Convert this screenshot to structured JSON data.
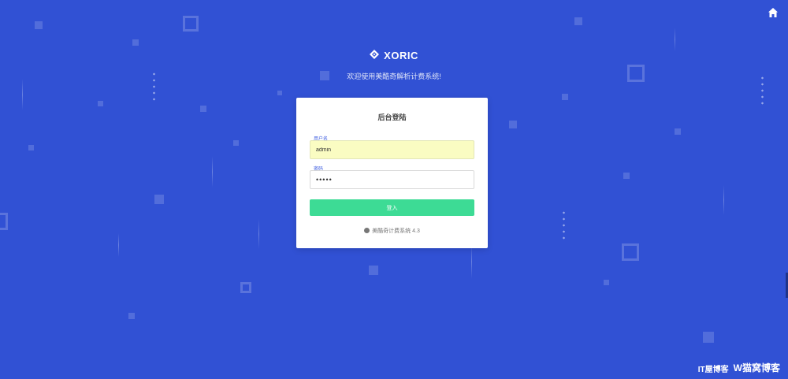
{
  "header": {
    "home_icon": "home-icon"
  },
  "brand": {
    "logo_icon": "diamond-logo-icon",
    "name": "XORIC",
    "tagline": "欢迎使用美酷奇解析计费系统!"
  },
  "login": {
    "title": "后台登陆",
    "username": {
      "label": "用户名",
      "value": "admin"
    },
    "password": {
      "label": "密码",
      "value": "•••••"
    },
    "submit_label": "登入",
    "footer_text": "美酷奇计费系统 4.3",
    "footer_icon": "info-circle-icon"
  },
  "watermark": {
    "left": "IT屋博客",
    "right": "W猫窝博客"
  },
  "colors": {
    "background": "#3151d4",
    "accent": "#3ddb95",
    "autofill": "#fafcc2"
  }
}
